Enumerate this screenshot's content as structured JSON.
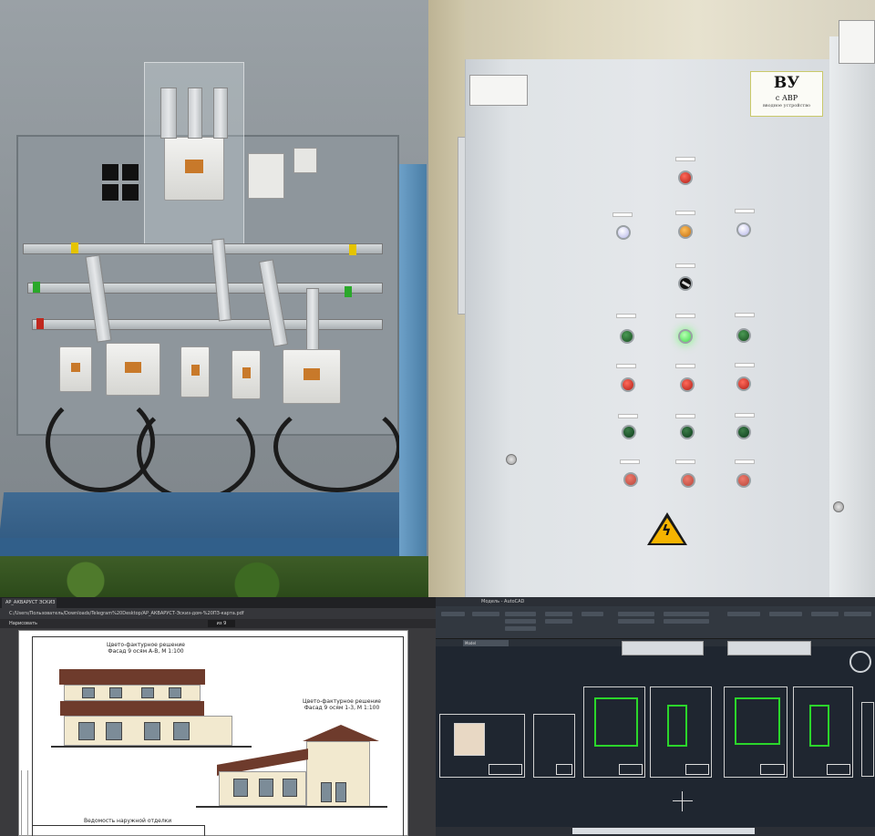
{
  "panel_label": {
    "title": "ВУ",
    "subtitle": "с АВР",
    "note": "вводное устройство"
  },
  "pdf_viewer": {
    "tab_title": "АР_АКВАРУСТ ЭСКИЗ ДОМА.pdf",
    "url": "C:/Users/Пользователь/Downloads/Telegram%20Desktop/АР_АКВАРУСТ-Эскиз-дом-%20ПЗ-карта.pdf",
    "toolbar_label": "Нарисовать",
    "page_indicator": "из 9",
    "drawing_title_1": "Цвето-фактурное решение",
    "drawing_subtitle_1": "Фасад 9 осям А-В, М 1:100",
    "drawing_title_2": "Цвето-фактурное решение",
    "drawing_subtitle_2": "Фасад 9 осям 1-3, М 1:100",
    "table_title": "Ведомость наружной отделки"
  },
  "cad": {
    "window_title": "Модель - AutoCAD",
    "active_tab": "Model"
  },
  "colors": {
    "cad_bg": "#1f2630",
    "plan_green": "#2bd62b",
    "roof_brown": "#6e3b2c",
    "warning_yellow": "#f5b400"
  }
}
